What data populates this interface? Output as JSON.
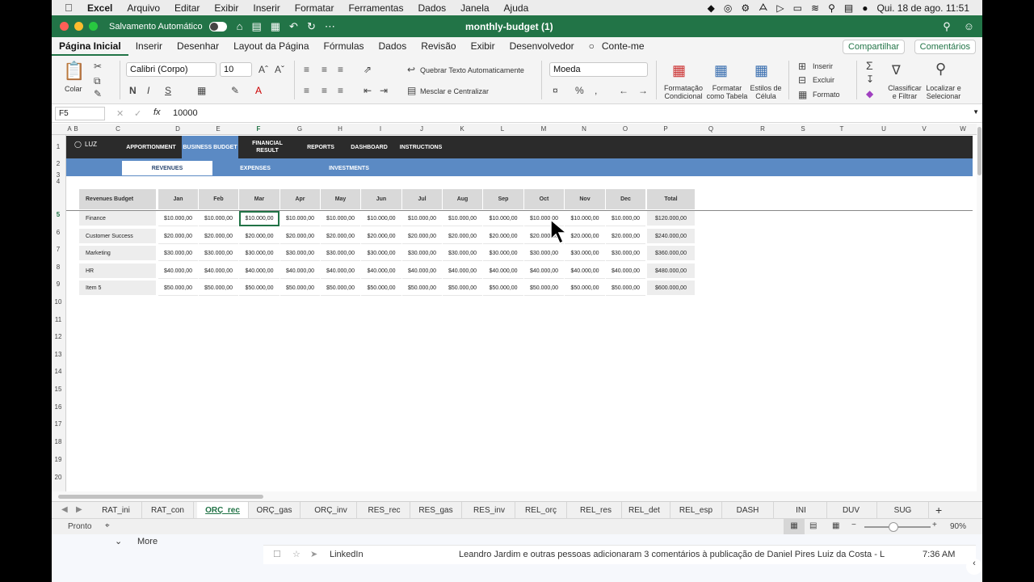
{
  "menubar": {
    "app": "Excel",
    "items": [
      "Arquivo",
      "Editar",
      "Exibir",
      "Inserir",
      "Formatar",
      "Ferramentas",
      "Dados",
      "Janela",
      "Ajuda"
    ],
    "datetime": "Qui. 18 de ago.  11:51"
  },
  "titlebar": {
    "autosave": "Salvamento Automático",
    "document": "monthly-budget (1)"
  },
  "ribbon_tabs": [
    "Página Inicial",
    "Inserir",
    "Desenhar",
    "Layout da Página",
    "Fórmulas",
    "Dados",
    "Revisão",
    "Exibir",
    "Desenvolvedor",
    "Conte-me"
  ],
  "share": "Compartilhar",
  "comments": "Comentários",
  "ribbon": {
    "paste": "Colar",
    "font": "Calibri (Corpo)",
    "size": "10",
    "bold": "N",
    "italic": "I",
    "underline": "S",
    "wrap": "Quebrar Texto Automaticamente",
    "merge": "Mesclar e Centralizar",
    "number_format": "Moeda",
    "cond_format": "Formatação Condicional",
    "format_table": "Formatar como Tabela",
    "cell_styles": "Estilos de Célula",
    "insert": "Inserir",
    "delete": "Excluir",
    "format": "Formato",
    "sort_filter": "Classificar e Filtrar",
    "find_select": "Localizar e Selecionar"
  },
  "formula_bar": {
    "cell_ref": "F5",
    "fx": "fx",
    "value": "10000"
  },
  "columns": [
    "A",
    "B",
    "C",
    "D",
    "E",
    "F",
    "G",
    "H",
    "I",
    "J",
    "K",
    "L",
    "M",
    "N",
    "O",
    "P",
    "Q",
    "R",
    "S",
    "T",
    "U",
    "V",
    "W"
  ],
  "rows": [
    "1",
    "2",
    "3",
    "4",
    "5",
    "6",
    "7",
    "8",
    "9",
    "10",
    "11",
    "12",
    "13",
    "14",
    "15",
    "16",
    "17",
    "18",
    "19",
    "20"
  ],
  "nav": {
    "logo": "LUZ",
    "items": [
      "APPORTIONMENT",
      "BUSINESS BUDGET",
      "FINANCIAL RESULT",
      "REPORTS",
      "DASHBOARD",
      "INSTRUCTIONS"
    ]
  },
  "subnav": [
    "REVENUES",
    "EXPENSES",
    "INVESTMENTS"
  ],
  "table": {
    "header": [
      "Revenues Budget",
      "Jan",
      "Feb",
      "Mar",
      "Apr",
      "May",
      "Jun",
      "Jul",
      "Aug",
      "Sep",
      "Oct",
      "Nov",
      "Dec",
      "Total"
    ],
    "rows": [
      [
        "Finance",
        "$10.000,00",
        "$10.000,00",
        "$10.000,00",
        "$10.000,00",
        "$10.000,00",
        "$10.000,00",
        "$10.000,00",
        "$10.000,00",
        "$10.000,00",
        "$10.000,00",
        "$10.000,00",
        "$10.000,00",
        "$120.000,00"
      ],
      [
        "Customer Success",
        "$20.000,00",
        "$20.000,00",
        "$20.000,00",
        "$20.000,00",
        "$20.000,00",
        "$20.000,00",
        "$20.000,00",
        "$20.000,00",
        "$20.000,00",
        "$20.000,00",
        "$20.000,00",
        "$20.000,00",
        "$240.000,00"
      ],
      [
        "Marketing",
        "$30.000,00",
        "$30.000,00",
        "$30.000,00",
        "$30.000,00",
        "$30.000,00",
        "$30.000,00",
        "$30.000,00",
        "$30.000,00",
        "$30.000,00",
        "$30.000,00",
        "$30.000,00",
        "$30.000,00",
        "$360.000,00"
      ],
      [
        "HR",
        "$40.000,00",
        "$40.000,00",
        "$40.000,00",
        "$40.000,00",
        "$40.000,00",
        "$40.000,00",
        "$40.000,00",
        "$40.000,00",
        "$40.000,00",
        "$40.000,00",
        "$40.000,00",
        "$40.000,00",
        "$480.000,00"
      ],
      [
        "Item 5",
        "$50.000,00",
        "$50.000,00",
        "$50.000,00",
        "$50.000,00",
        "$50.000,00",
        "$50.000,00",
        "$50.000,00",
        "$50.000,00",
        "$50.000,00",
        "$50.000,00",
        "$50.000,00",
        "$50.000,00",
        "$600.000,00"
      ]
    ]
  },
  "sheets": [
    "RAT_ini",
    "RAT_con",
    "ORÇ_rec",
    "ORÇ_gas",
    "ORÇ_inv",
    "RES_rec",
    "RES_gas",
    "RES_inv",
    "REL_orç",
    "REL_res",
    "REL_det",
    "REL_esp",
    "DASH",
    "INI",
    "DUV",
    "SUG"
  ],
  "active_sheet": "ORÇ_rec",
  "status": {
    "ready": "Pronto",
    "zoom": "90%"
  },
  "mail": {
    "more": "More",
    "sender": "LinkedIn",
    "subject": "Leandro Jardim e outras pessoas adicionaram 3 comentários à publicação de Daniel Pires Luiz da Costa - L",
    "time": "7:36 AM"
  },
  "colors": {
    "excel_green": "#227447",
    "nav_dark": "#2b2b2b",
    "nav_blue": "#5b8ac4"
  }
}
